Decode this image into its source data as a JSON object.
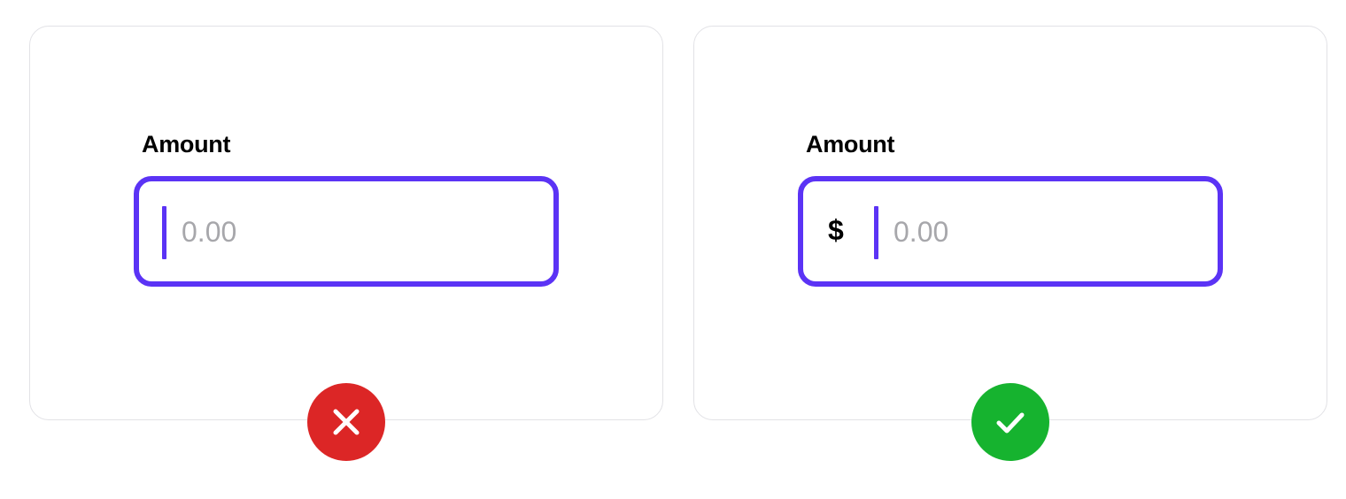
{
  "examples": {
    "bad": {
      "label": "Amount",
      "placeholder": "0.00",
      "verdict_icon": "close-icon",
      "verdict_color": "#dc2626"
    },
    "good": {
      "label": "Amount",
      "prefix": "$",
      "placeholder": "0.00",
      "verdict_icon": "check-icon",
      "verdict_color": "#16b32f"
    }
  },
  "colors": {
    "accent": "#5b33f5",
    "placeholder_text": "#a7a7ab",
    "card_border": "#e2e2e6"
  }
}
